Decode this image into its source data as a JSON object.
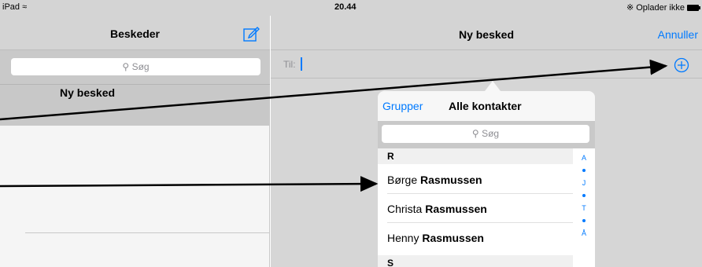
{
  "status_bar": {
    "device": "iPad",
    "time": "20.44",
    "charging": "Oplader ikke"
  },
  "sidebar": {
    "title": "Beskeder",
    "search_placeholder": "Søg",
    "items": [
      {
        "label": "Ny besked"
      }
    ]
  },
  "compose": {
    "title": "Ny besked",
    "cancel_label": "Annuller",
    "to_label": "Til:"
  },
  "contacts_popover": {
    "groups_label": "Grupper",
    "title": "Alle kontakter",
    "search_placeholder": "Søg",
    "sections": [
      {
        "letter": "R",
        "contacts": [
          {
            "first": "Børge",
            "last": "Rasmussen"
          },
          {
            "first": "Christa",
            "last": "Rasmussen"
          },
          {
            "first": "Henny",
            "last": "Rasmussen"
          }
        ]
      },
      {
        "letter": "S",
        "contacts": []
      }
    ],
    "index": [
      "A",
      "•",
      "J",
      "•",
      "T",
      "•",
      "Å"
    ]
  },
  "colors": {
    "accent": "#007aff",
    "bar": "#d4d4d4",
    "selected": "#c8c8c8"
  }
}
